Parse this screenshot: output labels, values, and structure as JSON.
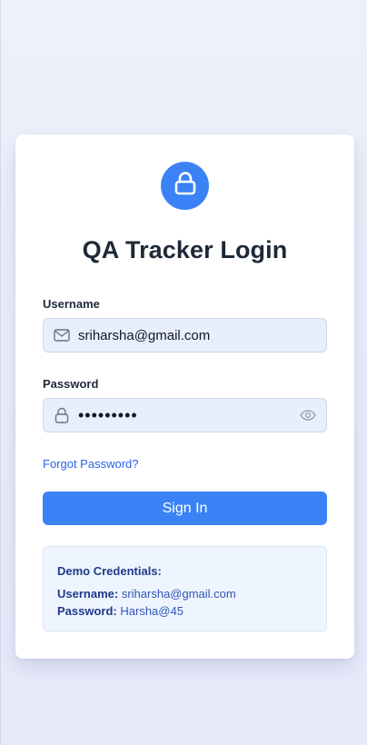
{
  "login": {
    "title": "QA Tracker Login",
    "username_label": "Username",
    "username_value": "sriharsha@gmail.com",
    "password_label": "Password",
    "password_masked": "•••••••••",
    "forgot_link": "Forgot Password?",
    "signin_label": "Sign In"
  },
  "demo": {
    "title": "Demo Credentials:",
    "username_key": "Username:",
    "username_value": "sriharsha@gmail.com",
    "password_key": "Password:",
    "password_value": "Harsha@45"
  },
  "icons": {
    "badge": "lock-icon",
    "username": "mail-icon",
    "password": "lock-icon",
    "toggle": "eye-icon"
  },
  "colors": {
    "accent": "#3b82f6",
    "link": "#2563eb",
    "field_bg": "#e8eefb",
    "demo_bg": "#eff5ff"
  }
}
